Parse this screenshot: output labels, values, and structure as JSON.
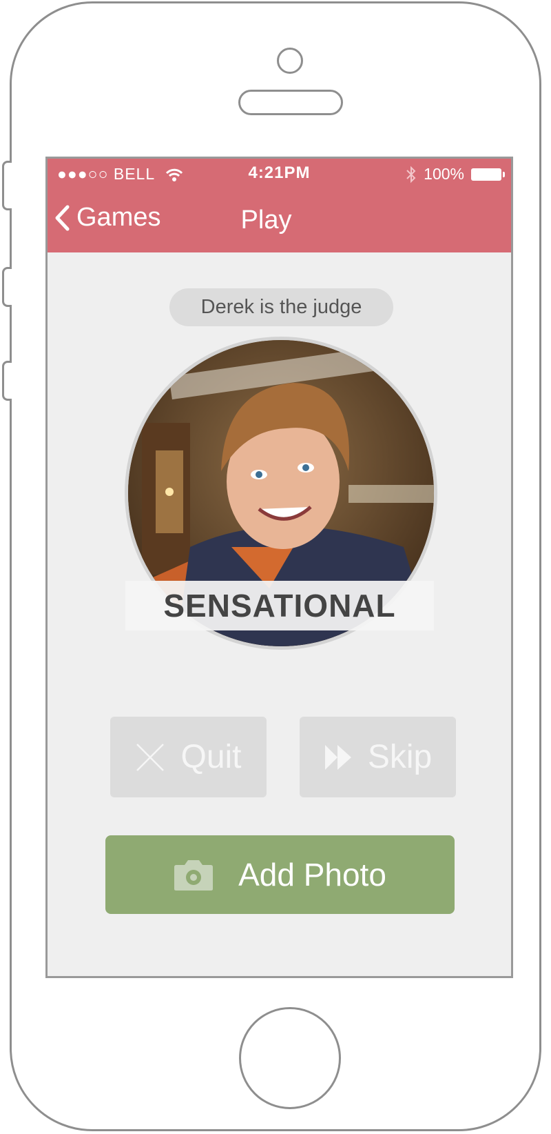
{
  "status_bar": {
    "carrier": "●●●○○ BELL",
    "time": "4:21PM",
    "battery": "100%"
  },
  "nav": {
    "back_label": "Games",
    "title": "Play"
  },
  "judge_text": "Derek is the judge",
  "caption": "SENSATIONAL",
  "actions": {
    "quit_label": "Quit",
    "skip_label": "Skip",
    "add_photo_label": "Add Photo"
  },
  "colors": {
    "header": "#d66b74",
    "add_button": "#8faa72",
    "disabled_button": "#dcdcdc",
    "screen_bg": "#efefef"
  },
  "icons": [
    "wifi-icon",
    "bluetooth-icon",
    "battery-icon",
    "back-chevron-icon",
    "close-icon",
    "fast-forward-icon",
    "camera-icon"
  ]
}
